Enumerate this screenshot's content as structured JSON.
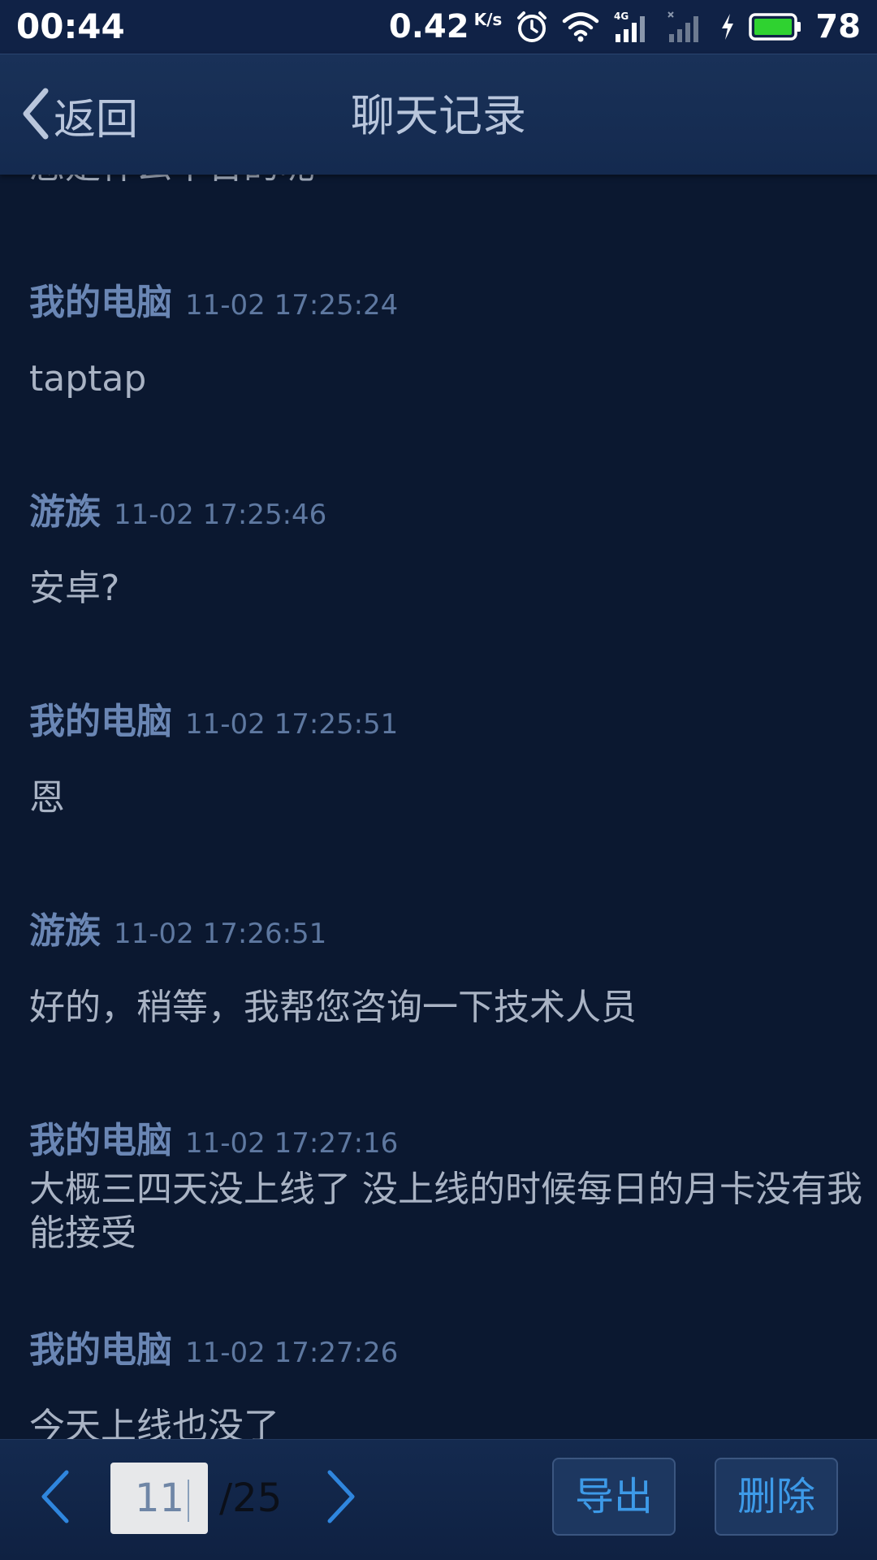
{
  "status_bar": {
    "time": "00:44",
    "net_speed": "0.42",
    "net_speed_unit": "K/s",
    "network_type": "4G",
    "battery_level": "78",
    "icons": [
      "alarm-icon",
      "wifi-icon",
      "signal-4g-icon",
      "signal-empty-icon",
      "charging-icon",
      "battery-icon"
    ]
  },
  "header": {
    "back_label": "返回",
    "title": "聊天记录"
  },
  "messages": [
    {
      "sender": "",
      "time": "",
      "text": "您是什么平台的呢"
    },
    {
      "sender": "我的电脑",
      "time": "11-02 17:25:24",
      "text": "taptap"
    },
    {
      "sender": "游族",
      "time": "11-02 17:25:46",
      "text": "安卓?"
    },
    {
      "sender": "我的电脑",
      "time": "11-02 17:25:51",
      "text": "恩"
    },
    {
      "sender": "游族",
      "time": "11-02 17:26:51",
      "text": "好的，稍等，我帮您咨询一下技术人员"
    },
    {
      "sender": "我的电脑",
      "time": "11-02 17:27:16",
      "text": "大概三四天没上线了 没上线的时候每日的月卡没有我能接受"
    },
    {
      "sender": "我的电脑",
      "time": "11-02 17:27:26",
      "text": "今天上线也没了"
    }
  ],
  "pagination": {
    "current_page": "11",
    "total_label": "/25",
    "prev_icon": "chevron-left-icon",
    "next_icon": "chevron-right-icon"
  },
  "actions": {
    "export_label": "导出",
    "delete_label": "删除"
  },
  "colors": {
    "background": "#0b1830",
    "header": "#193158",
    "sender": "#6a86b4",
    "accent_blue": "#3d9ae8"
  }
}
